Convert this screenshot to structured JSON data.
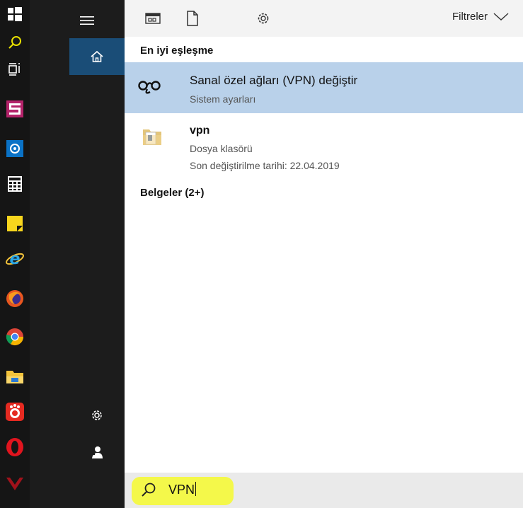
{
  "toolbar": {
    "filters_label": "Filtreler"
  },
  "best_match": {
    "heading": "En iyi eşleşme",
    "title": "Sanal özel ağları (VPN) değiştir",
    "subtitle": "Sistem ayarları"
  },
  "file_result": {
    "title": "vpn",
    "type": "Dosya klasörü",
    "modified": "Son değiştirilme tarihi: 22.04.2019"
  },
  "documents": {
    "heading": "Belgeler (2+)"
  },
  "search": {
    "query": "VPN"
  },
  "colors": {
    "selection": "#b9d1ea",
    "nav_active": "#1a4d77",
    "highlight": "#f4f84a",
    "search_accent": "#d4c100"
  },
  "taskbar_icons": [
    "windows-logo",
    "search-icon",
    "task-view-icon",
    "app-icon",
    "outlook-icon",
    "calculator-icon",
    "sticky-notes-icon",
    "internet-explorer-icon",
    "firefox-icon",
    "chrome-icon",
    "file-explorer-icon",
    "app-icon",
    "opera-icon",
    "vivaldi-icon"
  ],
  "nav_icons": [
    "hamburger-icon",
    "home-icon",
    "settings-icon",
    "user-icon"
  ],
  "toolbar_icons": [
    "apps-icon",
    "document-icon",
    "settings-icon",
    "chevron-down-icon"
  ]
}
